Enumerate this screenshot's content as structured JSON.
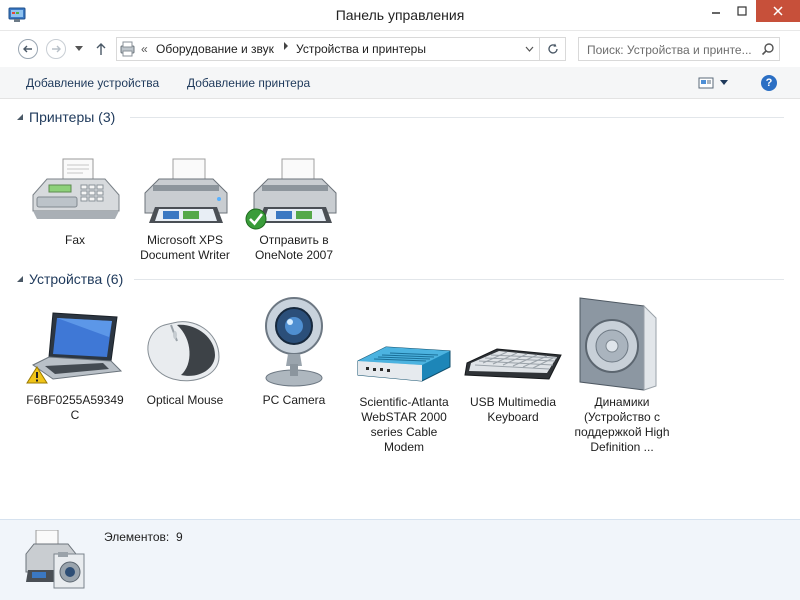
{
  "window": {
    "title": "Панель управления",
    "app_icon": "control-panel-icon"
  },
  "nav": {
    "breadcrumb_prefix": "«",
    "crumbs": [
      "Оборудование и звук",
      "Устройства и принтеры"
    ],
    "search_placeholder": "Поиск: Устройства и принте..."
  },
  "commands": {
    "add_device": "Добавление устройства",
    "add_printer": "Добавление принтера"
  },
  "groups": {
    "printers": {
      "title": "Принтеры (3)",
      "items": [
        {
          "label": "Fax",
          "icon": "fax-icon"
        },
        {
          "label": "Microsoft XPS Document Writer",
          "icon": "printer-icon"
        },
        {
          "label": "Отправить в OneNote 2007",
          "icon": "default-printer-icon",
          "badge": "checkmark"
        }
      ]
    },
    "devices": {
      "title": "Устройства (6)",
      "items": [
        {
          "label": "F6BF0255A59349 C",
          "icon": "laptop-icon",
          "badge": "warning"
        },
        {
          "label": "Optical Mouse",
          "icon": "mouse-icon"
        },
        {
          "label": "PC Camera",
          "icon": "webcam-icon"
        },
        {
          "label": "Scientific-Atlanta WebSTAR 2000 series Cable Modem",
          "icon": "modem-icon"
        },
        {
          "label": "USB Multimedia Keyboard",
          "icon": "keyboard-icon"
        },
        {
          "label": "Динамики (Устройство с поддержкой High Definition ...",
          "icon": "speaker-icon"
        }
      ]
    }
  },
  "status": {
    "label": "Элементов:",
    "count": "9"
  },
  "colors": {
    "link": "#1e395b",
    "close_button": "#c7503a",
    "statusbar_bg": "#f1f5fa",
    "help": "#2b6fc4"
  }
}
